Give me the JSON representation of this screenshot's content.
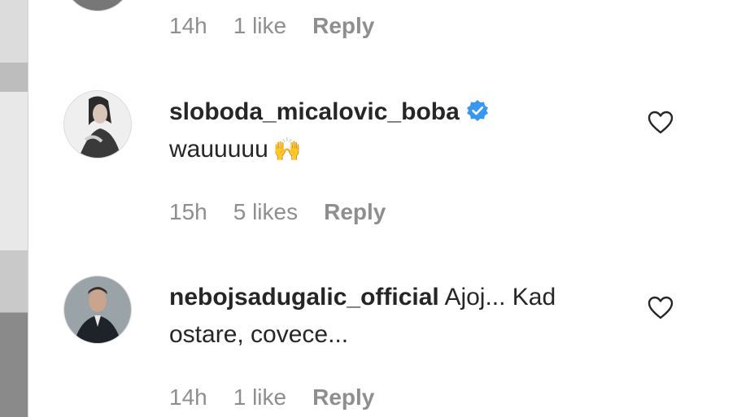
{
  "comments": [
    {
      "id": "top",
      "time": "14h",
      "likes": "1 like",
      "reply": "Reply"
    },
    {
      "id": "boba",
      "username": "sloboda_micalovic_boba",
      "verified": true,
      "text": "wauuuuu",
      "emoji": "🙌",
      "time": "15h",
      "likes": "5 likes",
      "reply": "Reply"
    },
    {
      "id": "nebojsa",
      "username": "nebojsadugalic_official",
      "text": "Ajoj... Kad ostare, covece...",
      "time": "14h",
      "likes": "1 like",
      "reply": "Reply"
    }
  ],
  "colors": {
    "verified_blue": "#3897f0",
    "meta_gray": "#8e8e8e",
    "text_dark": "#262626"
  },
  "icons": {
    "heart": "heart-outline-icon",
    "verified": "verified-badge-icon"
  }
}
